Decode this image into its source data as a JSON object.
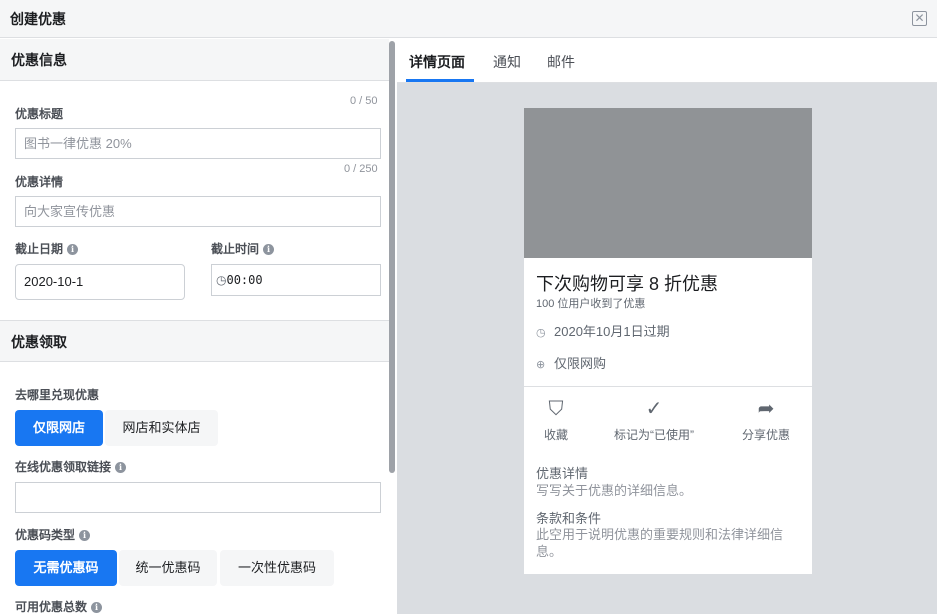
{
  "window": {
    "title": "创建优惠",
    "close_icon": "close-icon"
  },
  "offer_info": {
    "heading": "优惠信息",
    "title_label": "优惠标题",
    "title_counter": "0 / 50",
    "title_placeholder": "图书一律优惠 20%",
    "details_label": "优惠详情",
    "details_counter": "0 / 250",
    "details_placeholder": "向大家宣传优惠",
    "end_date_label": "截止日期",
    "end_date_value": "2020-10-1",
    "end_time_label": "截止时间",
    "end_time_value": "00:00"
  },
  "redemption": {
    "heading": "优惠领取",
    "where_label": "去哪里兑现优惠",
    "where_options": [
      "仅限网店",
      "网店和实体店"
    ],
    "where_selected": 0,
    "link_label": "在线优惠领取链接",
    "link_value": "",
    "code_type_label": "优惠码类型",
    "code_type_options": [
      "无需优惠码",
      "统一优惠码",
      "一次性优惠码"
    ],
    "code_type_selected": 0,
    "total_label": "可用优惠总数"
  },
  "preview": {
    "tabs": [
      "详情页面",
      "通知",
      "邮件"
    ],
    "active_tab": 0,
    "card": {
      "headline": "下次购物可享 8 折优惠",
      "claimed": "100 位用户收到了优惠",
      "expiry": "2020年10月1日过期",
      "scope": "仅限网购",
      "actions": [
        {
          "label": "收藏",
          "icon": "save-icon"
        },
        {
          "label": "标记为“已使用”",
          "icon": "check-icon"
        },
        {
          "label": "分享优惠",
          "icon": "share-icon"
        }
      ],
      "details_title": "优惠详情",
      "details_body": "写写关于优惠的详细信息。",
      "terms_title": "条款和条件",
      "terms_body": "此空用于说明优惠的重要规则和法律详细信息。"
    }
  },
  "colors": {
    "accent": "#1877f2",
    "preview_bg": "#dadde1",
    "image_placeholder": "#909396"
  }
}
